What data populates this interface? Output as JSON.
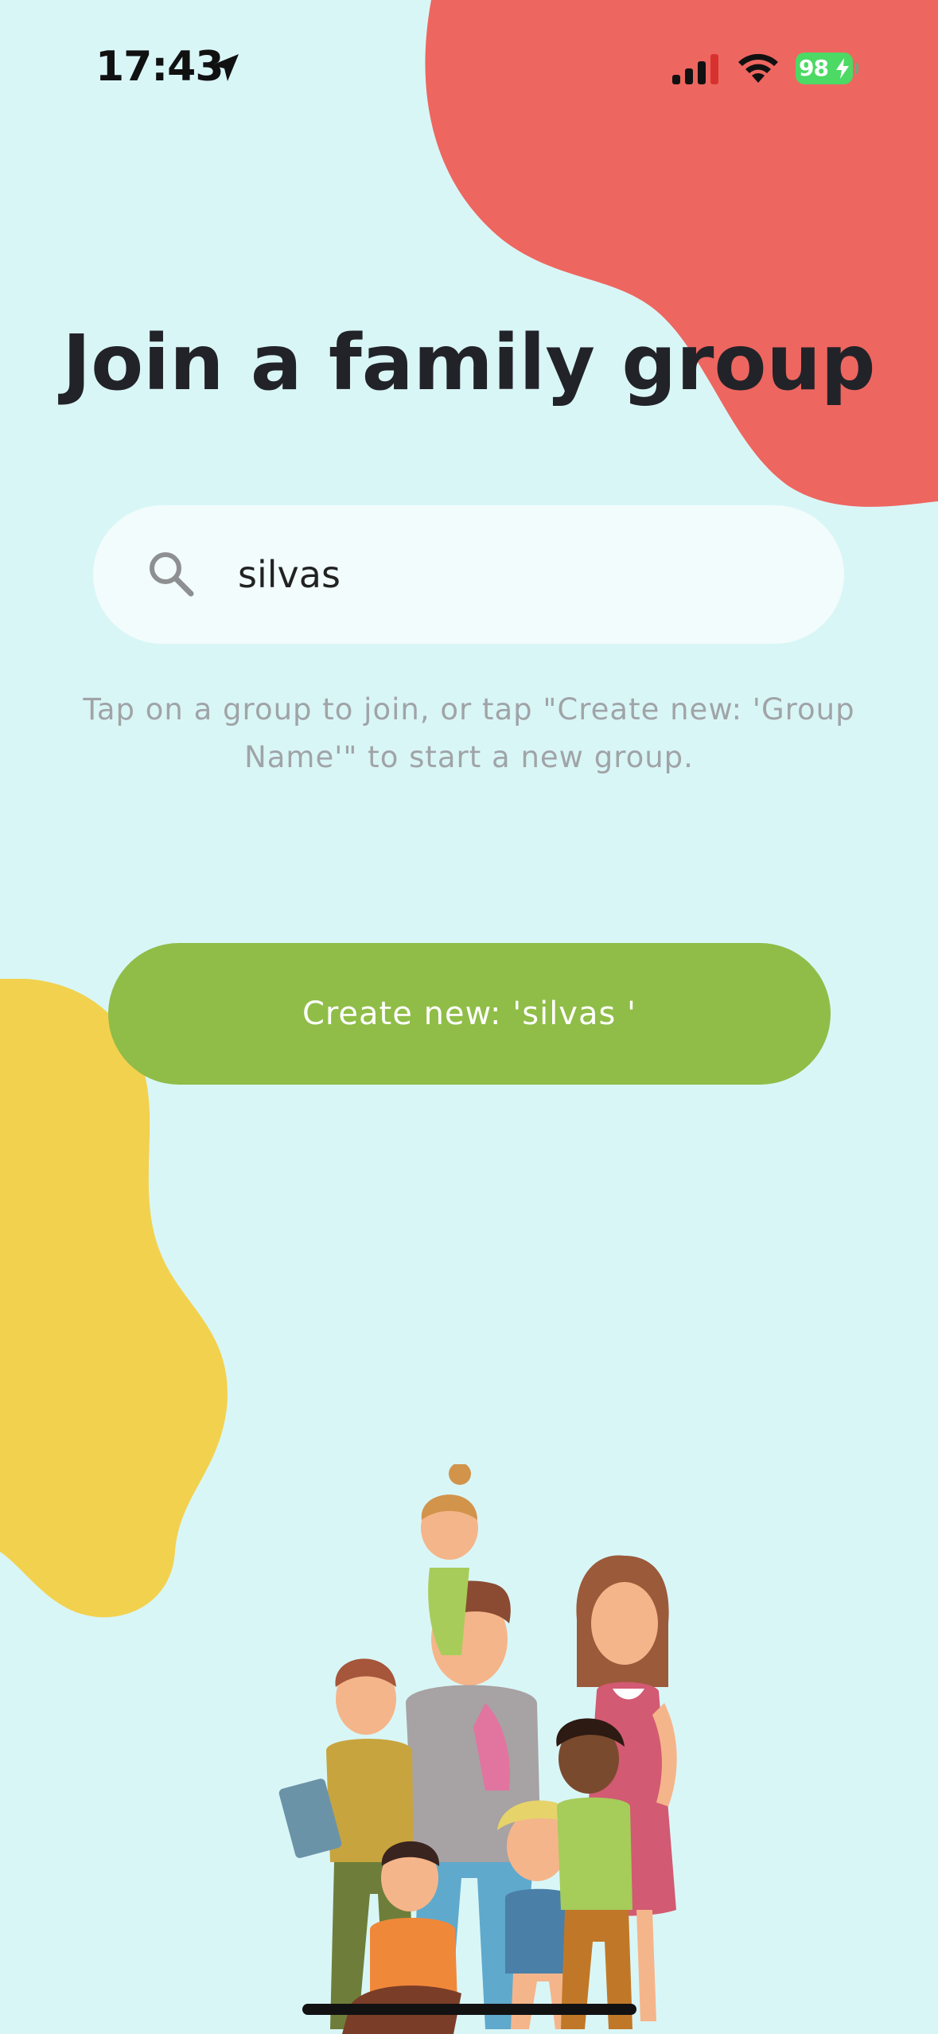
{
  "status_bar": {
    "time": "17:43",
    "battery_percent": "98",
    "icons": [
      "location-arrow-icon",
      "cellular-signal-icon",
      "wifi-icon",
      "battery-charging-icon"
    ]
  },
  "header": {
    "title": "Join a family group"
  },
  "search": {
    "icon": "search-icon",
    "value": "silvas",
    "placeholder": ""
  },
  "hint": {
    "text": "Tap on a group to join, or tap \"Create new: 'Group Name'\" to start a new group."
  },
  "create_button": {
    "label": "Create new: 'silvas '"
  },
  "colors": {
    "background": "#d9f6f7",
    "red_blob": "#ee6660",
    "yellow_blob": "#f2d14e",
    "button_green": "#8fbd47",
    "search_bg": "#f2fcfc",
    "battery_green": "#4cd964"
  },
  "illustration": {
    "name": "family-group-illustration"
  }
}
